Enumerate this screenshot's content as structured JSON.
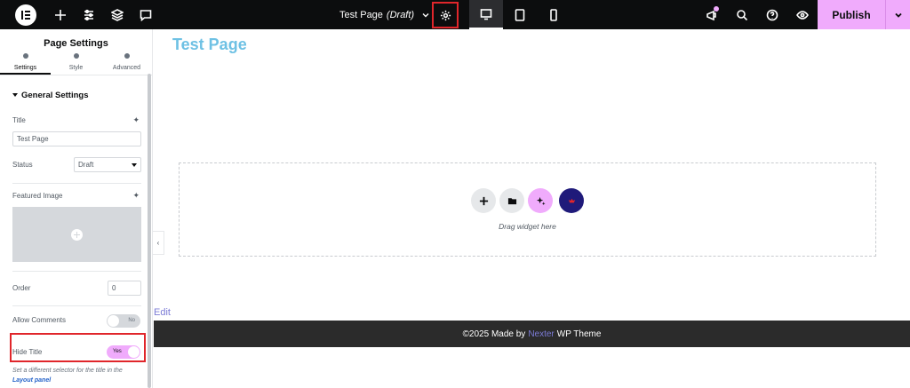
{
  "topbar": {
    "document_title": "Test Page",
    "document_status": "(Draft)",
    "publish_label": "Publish"
  },
  "panel": {
    "title": "Page Settings",
    "tabs": [
      {
        "label": "Settings"
      },
      {
        "label": "Style"
      },
      {
        "label": "Advanced"
      }
    ],
    "section_title": "General Settings",
    "fields": {
      "title_label": "Title",
      "title_value": "Test Page",
      "status_label": "Status",
      "status_value": "Draft",
      "featured_image_label": "Featured Image",
      "order_label": "Order",
      "order_value": "0",
      "allow_comments_label": "Allow Comments",
      "allow_comments_value": "No",
      "hide_title_label": "Hide Title",
      "hide_title_value": "Yes"
    },
    "help_text": "Set a different selector for the title in the",
    "help_link": "Layout panel"
  },
  "canvas": {
    "page_heading": "Test Page",
    "drop_text": "Drag widget here",
    "edit_link": "Edit",
    "footer": {
      "prefix": "©2025 Made by",
      "brand": "Nexter",
      "suffix": "WP Theme"
    }
  },
  "colors": {
    "accent": "#f0abfc",
    "heading": "#6ec1e4",
    "highlight": "#e0262b"
  }
}
